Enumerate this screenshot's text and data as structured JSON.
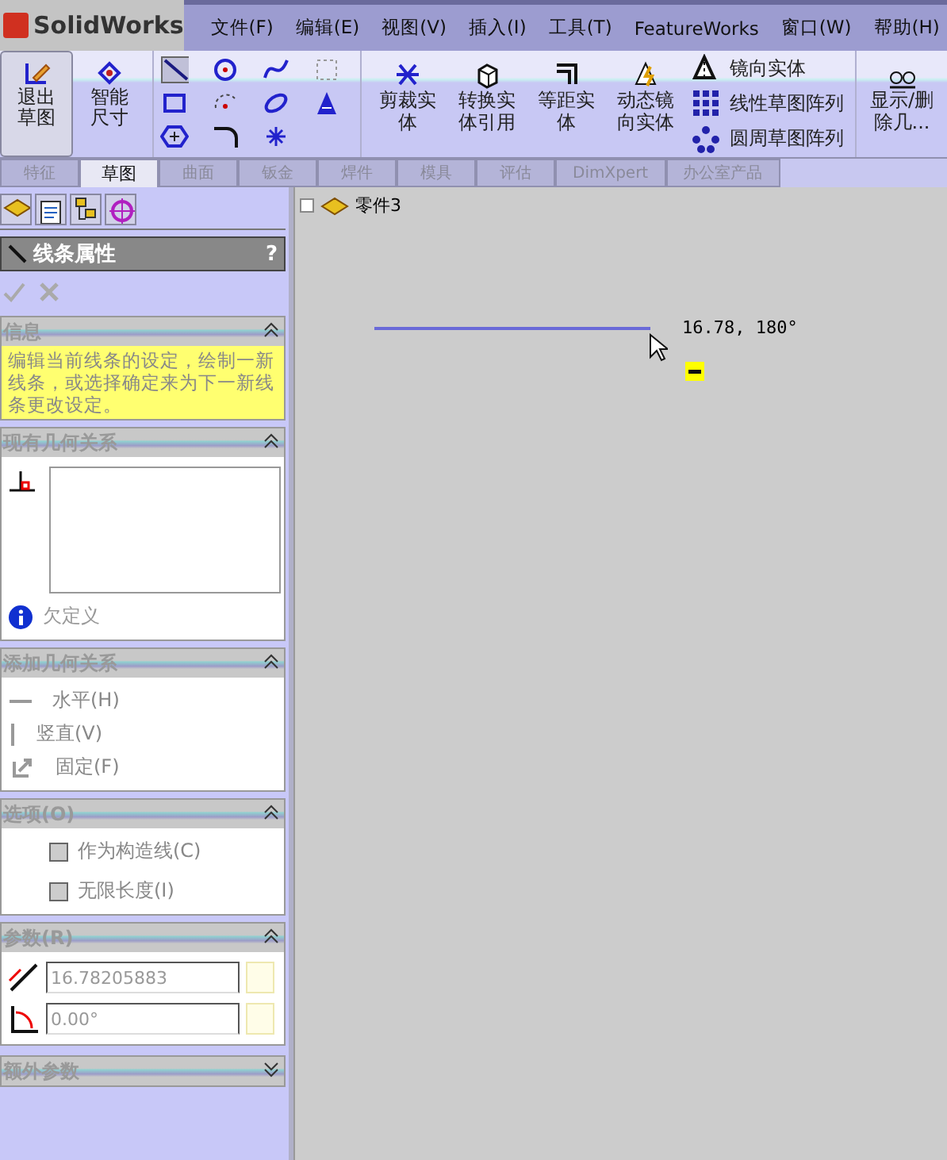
{
  "app": {
    "logo": "SolidWorks"
  },
  "menu": [
    "文件(F)",
    "编辑(E)",
    "视图(V)",
    "插入(I)",
    "工具(T)",
    "FeatureWorks",
    "窗口(W)",
    "帮助(H)"
  ],
  "toolbar": {
    "big_buttons": [
      {
        "label": "退出草图",
        "kind": "exit",
        "selected": true
      },
      {
        "label": "智能尺寸",
        "kind": "dim",
        "selected": false
      }
    ],
    "tool_buttons": [
      {
        "label": "剪裁实体",
        "kind": "trim"
      },
      {
        "label": "转换实体引用",
        "kind": "convert"
      },
      {
        "label": "等距实体",
        "kind": "offset"
      },
      {
        "label": "动态镜向实体",
        "kind": "dynmirror"
      }
    ],
    "list_buttons": [
      {
        "label": "镜向实体",
        "kind": "mirror"
      },
      {
        "label": "线性草图阵列",
        "kind": "linear"
      },
      {
        "label": "圆周草图阵列",
        "kind": "circular"
      }
    ],
    "end_button": {
      "label": "显示/删除几..."
    }
  },
  "tabs": [
    {
      "label": "特征",
      "selected": false
    },
    {
      "label": "草图",
      "selected": true
    },
    {
      "label": "曲面",
      "selected": false
    },
    {
      "label": "钣金",
      "selected": false
    },
    {
      "label": "焊件",
      "selected": false
    },
    {
      "label": "模具",
      "selected": false
    },
    {
      "label": "评估",
      "selected": false
    },
    {
      "label": "DimXpert",
      "selected": false
    },
    {
      "label": "办公室产品",
      "selected": false
    }
  ],
  "panel": {
    "title": "线条属性",
    "help": "?",
    "sections": [
      {
        "kind": "message",
        "title": "信息",
        "expanded": true,
        "text": "编辑当前线条的设定，绘制一新线条，或选择确定来为下一新线条更改设定。"
      },
      {
        "kind": "relations",
        "title": "现有几何关系",
        "expanded": true,
        "status": "欠定义"
      },
      {
        "kind": "add",
        "title": "添加几何关系",
        "expanded": true,
        "items": [
          {
            "label": "水平(H)",
            "kind": "horizontal"
          },
          {
            "label": "竖直(V)",
            "kind": "vertical"
          },
          {
            "label": "固定(F)",
            "kind": "fix"
          }
        ]
      },
      {
        "kind": "options",
        "title": "选项(O)",
        "expanded": true,
        "items": [
          {
            "label": "作为构造线(C)",
            "checked": false
          },
          {
            "label": "无限长度(I)",
            "checked": false
          }
        ]
      },
      {
        "kind": "params",
        "title": "参数(R)",
        "expanded": true,
        "fields": [
          {
            "kind": "length",
            "value": "16.78205883"
          },
          {
            "kind": "angle",
            "value": "0.00°"
          }
        ]
      },
      {
        "kind": "extra",
        "title": "额外参数",
        "expanded": false
      }
    ]
  },
  "canvas": {
    "tree_item": "零件3",
    "dimension": "16.78, 180°"
  }
}
